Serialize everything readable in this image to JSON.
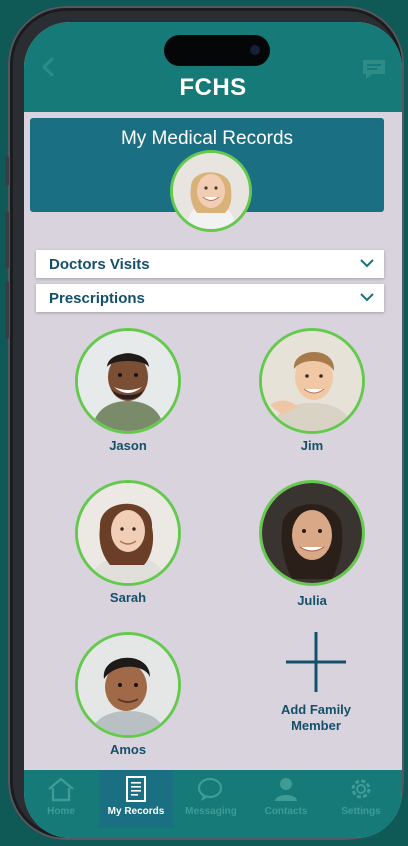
{
  "app": {
    "logo": "FCHS"
  },
  "header": {
    "title": "My Medical Records"
  },
  "dropdowns": [
    {
      "label": "Doctors Visits"
    },
    {
      "label": "Prescriptions"
    }
  ],
  "family": [
    {
      "name": "Jason"
    },
    {
      "name": "Jim"
    },
    {
      "name": "Sarah"
    },
    {
      "name": "Julia"
    },
    {
      "name": "Amos"
    }
  ],
  "add_member": {
    "label_line1": "Add Family",
    "label_line2": "Member"
  },
  "tabs": [
    {
      "label": "Home",
      "icon": "home-icon"
    },
    {
      "label": "My Records",
      "icon": "document-icon"
    },
    {
      "label": "Messaging",
      "icon": "chat-icon"
    },
    {
      "label": "Contacts",
      "icon": "contacts-icon"
    },
    {
      "label": "Settings",
      "icon": "gear-icon"
    }
  ],
  "colors": {
    "header_bar": "#167a78",
    "card": "#1b6f82",
    "accent_green": "#66c94f",
    "text_dark": "#15506a",
    "screen_bg": "#d8d3dc"
  }
}
